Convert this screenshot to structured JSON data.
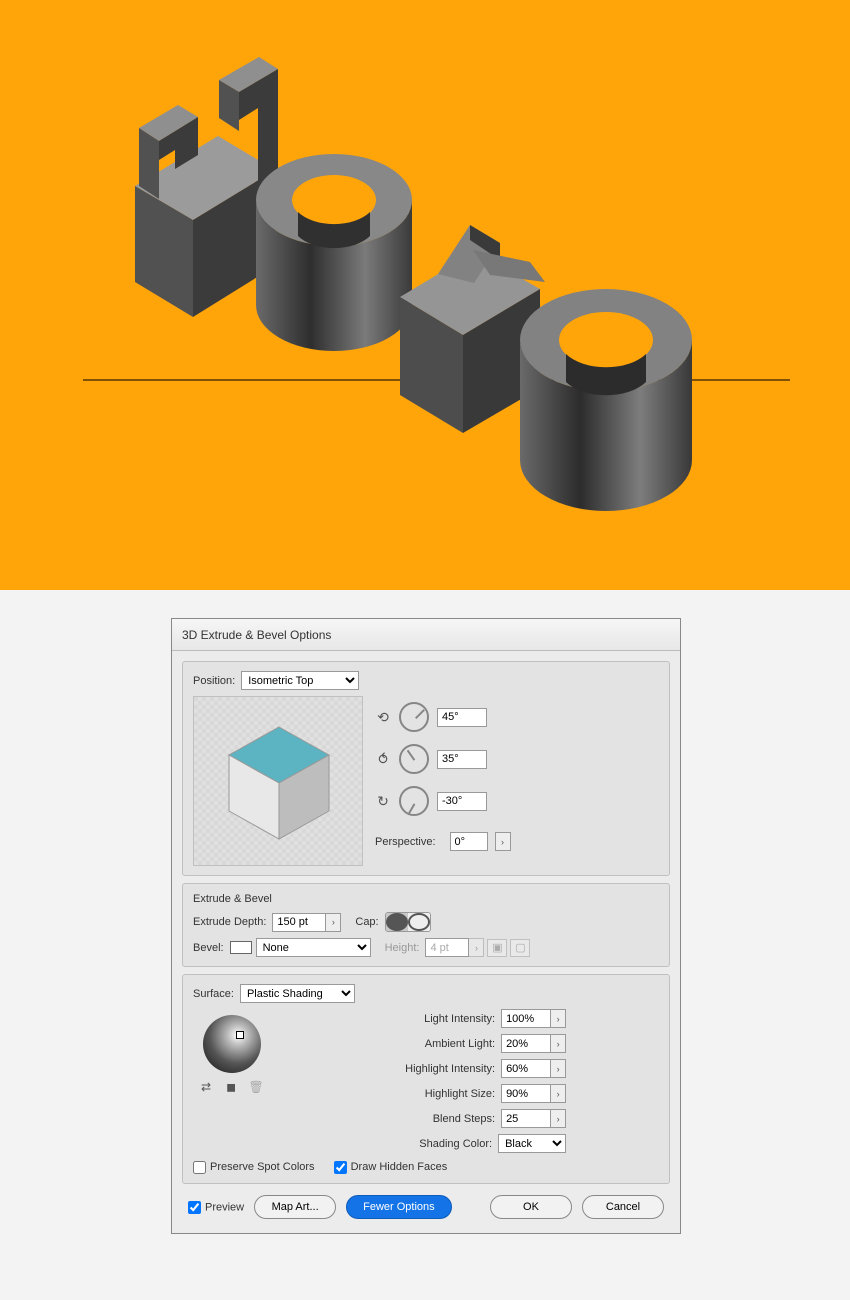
{
  "artwork": {
    "text": "HOYO"
  },
  "dialog": {
    "title": "3D Extrude & Bevel Options",
    "position_label": "Position:",
    "position_value": "Isometric Top",
    "rotations": {
      "x": "45°",
      "y": "35°",
      "z": "-30°"
    },
    "perspective_label": "Perspective:",
    "perspective_value": "0°",
    "extrude": {
      "section_title": "Extrude & Bevel",
      "depth_label": "Extrude Depth:",
      "depth_value": "150 pt",
      "cap_label": "Cap:",
      "bevel_label": "Bevel:",
      "bevel_value": "None",
      "height_label": "Height:",
      "height_value": "4 pt"
    },
    "surface": {
      "label": "Surface:",
      "value": "Plastic Shading",
      "light_intensity_label": "Light Intensity:",
      "light_intensity": "100%",
      "ambient_label": "Ambient Light:",
      "ambient": "20%",
      "hi_intensity_label": "Highlight Intensity:",
      "hi_intensity": "60%",
      "hi_size_label": "Highlight Size:",
      "hi_size": "90%",
      "blend_label": "Blend Steps:",
      "blend": "25",
      "shading_color_label": "Shading Color:",
      "shading_color": "Black",
      "preserve_spot": "Preserve Spot Colors",
      "draw_hidden": "Draw Hidden Faces"
    },
    "footer": {
      "preview": "Preview",
      "map_art": "Map Art...",
      "fewer": "Fewer Options",
      "ok": "OK",
      "cancel": "Cancel"
    }
  }
}
